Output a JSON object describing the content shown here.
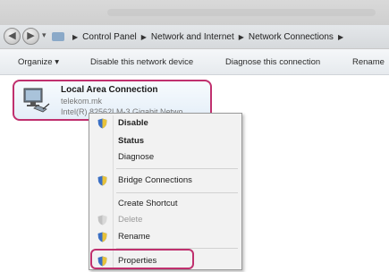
{
  "address": {
    "crumbs": [
      "Control Panel",
      "Network and Internet",
      "Network Connections"
    ]
  },
  "toolbar": {
    "organize": "Organize",
    "disable": "Disable this network device",
    "diagnose": "Diagnose this connection",
    "rename": "Rename"
  },
  "connection": {
    "name": "Local Area Connection",
    "network": "telekom.mk",
    "device": "Intel(R) 82562LM-3 Gigabit Netwo..."
  },
  "context_menu": {
    "disable": "Disable",
    "status": "Status",
    "diagnose": "Diagnose",
    "bridge": "Bridge Connections",
    "shortcut": "Create Shortcut",
    "delete": "Delete",
    "rename": "Rename",
    "properties": "Properties"
  },
  "colors": {
    "highlight": "#c0306e",
    "shield_blue": "#3a6fc4",
    "shield_yellow": "#e8c23a"
  },
  "icons": [
    "back-icon",
    "forward-icon",
    "folder-icon",
    "network-adapter-icon",
    "shield-icon"
  ]
}
